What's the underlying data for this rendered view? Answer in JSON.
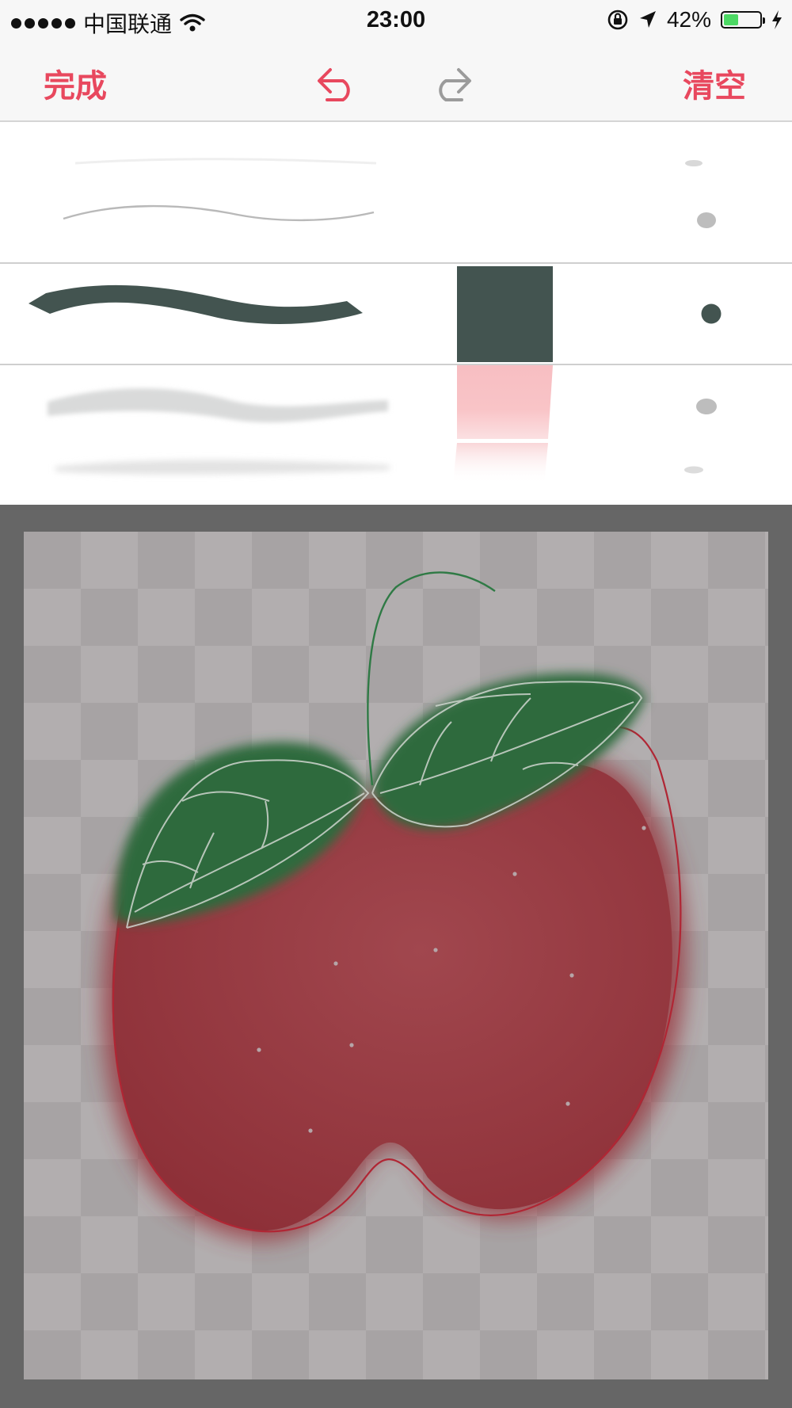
{
  "status_bar": {
    "carrier": "中国联通",
    "time": "23:00",
    "battery_percent": "42%",
    "battery_level": 0.42,
    "icons": [
      "signal-dots-icon",
      "wifi-icon",
      "orientation-lock-icon",
      "location-arrow-icon",
      "battery-icon",
      "charging-bolt-icon"
    ]
  },
  "nav_bar": {
    "done_label": "完成",
    "clear_label": "清空",
    "icons": [
      "undo-icon",
      "redo-icon"
    ],
    "accent_color": "#e8485e",
    "disabled_color": "#9b9b9b"
  },
  "palette": {
    "brushes": [
      "pencil-thin",
      "marker",
      "airbrush"
    ],
    "selected_brush": "marker",
    "colors": [
      "#435450",
      "#f7bec2"
    ],
    "selected_color": "#435450",
    "sizes": [
      "tiny",
      "small",
      "medium",
      "large-soft",
      "small-soft"
    ],
    "selected_size": "medium"
  },
  "canvas": {
    "drawing": "red-apple-with-green-leaves",
    "background_color": "#666666"
  }
}
